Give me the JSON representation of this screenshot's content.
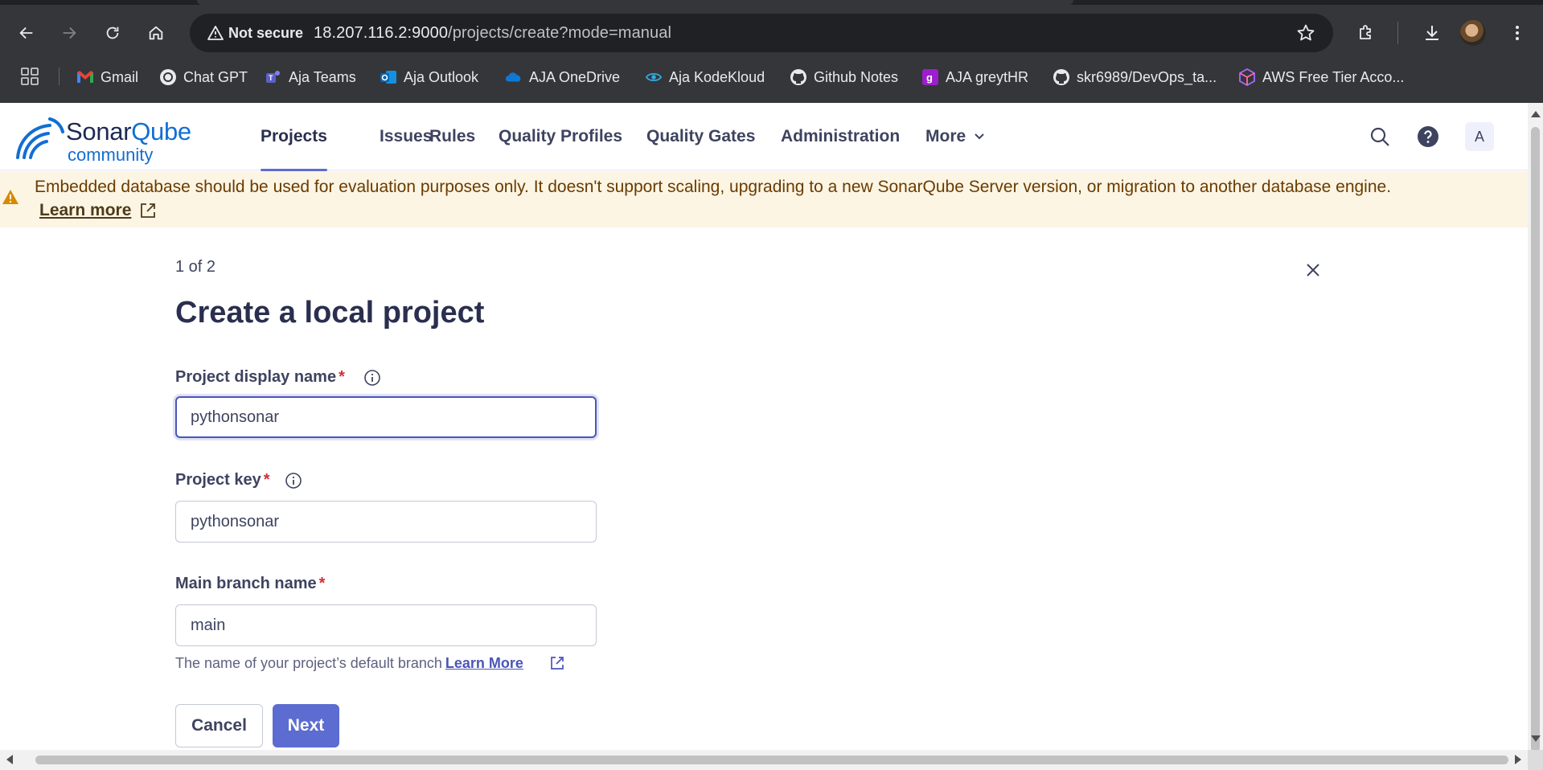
{
  "browser": {
    "security_label": "Not secure",
    "url_host": "18.207.116.2:9000",
    "url_path": "/projects/create?mode=manual",
    "bookmarks": [
      {
        "label": "Gmail",
        "icon": "gmail-icon"
      },
      {
        "label": "Chat GPT",
        "icon": "openai-icon"
      },
      {
        "label": "Aja Teams",
        "icon": "teams-icon"
      },
      {
        "label": "Aja Outlook",
        "icon": "outlook-icon"
      },
      {
        "label": "AJA OneDrive",
        "icon": "onedrive-icon"
      },
      {
        "label": "Aja KodeKloud",
        "icon": "kodekloud-icon"
      },
      {
        "label": "Github Notes",
        "icon": "github-icon"
      },
      {
        "label": "AJA greytHR",
        "icon": "greythr-icon"
      },
      {
        "label": "skr6989/DevOps_ta...",
        "icon": "github-icon"
      },
      {
        "label": "AWS Free Tier Acco...",
        "icon": "aws-icon"
      }
    ]
  },
  "app": {
    "logo_word_a": "Sonar",
    "logo_word_b": "Qube",
    "logo_sub": "community",
    "nav": [
      {
        "label": "Projects",
        "active": true
      },
      {
        "label": "Issues"
      },
      {
        "label": "Rules"
      },
      {
        "label": "Quality Profiles"
      },
      {
        "label": "Quality Gates"
      },
      {
        "label": "Administration"
      },
      {
        "label": "More"
      }
    ],
    "user_initial": "A",
    "accent_color": "#5d6cd0"
  },
  "banner": {
    "message": "Embedded database should be used for evaluation purposes only. It doesn't support scaling, upgrading to a new SonarQube Server version, or migration to another database engine.",
    "link": "Learn more"
  },
  "form": {
    "step": "1 of 2",
    "title": "Create a local project",
    "display_name": {
      "label": "Project display name",
      "required": "*",
      "value": "pythonsonar"
    },
    "project_key": {
      "label": "Project key",
      "required": "*",
      "value": "pythonsonar"
    },
    "main_branch": {
      "label": "Main branch name",
      "required": "*",
      "value": "main"
    },
    "help_text": "The name of your project’s default branch",
    "help_link": "Learn More",
    "cancel": "Cancel",
    "next": "Next"
  }
}
